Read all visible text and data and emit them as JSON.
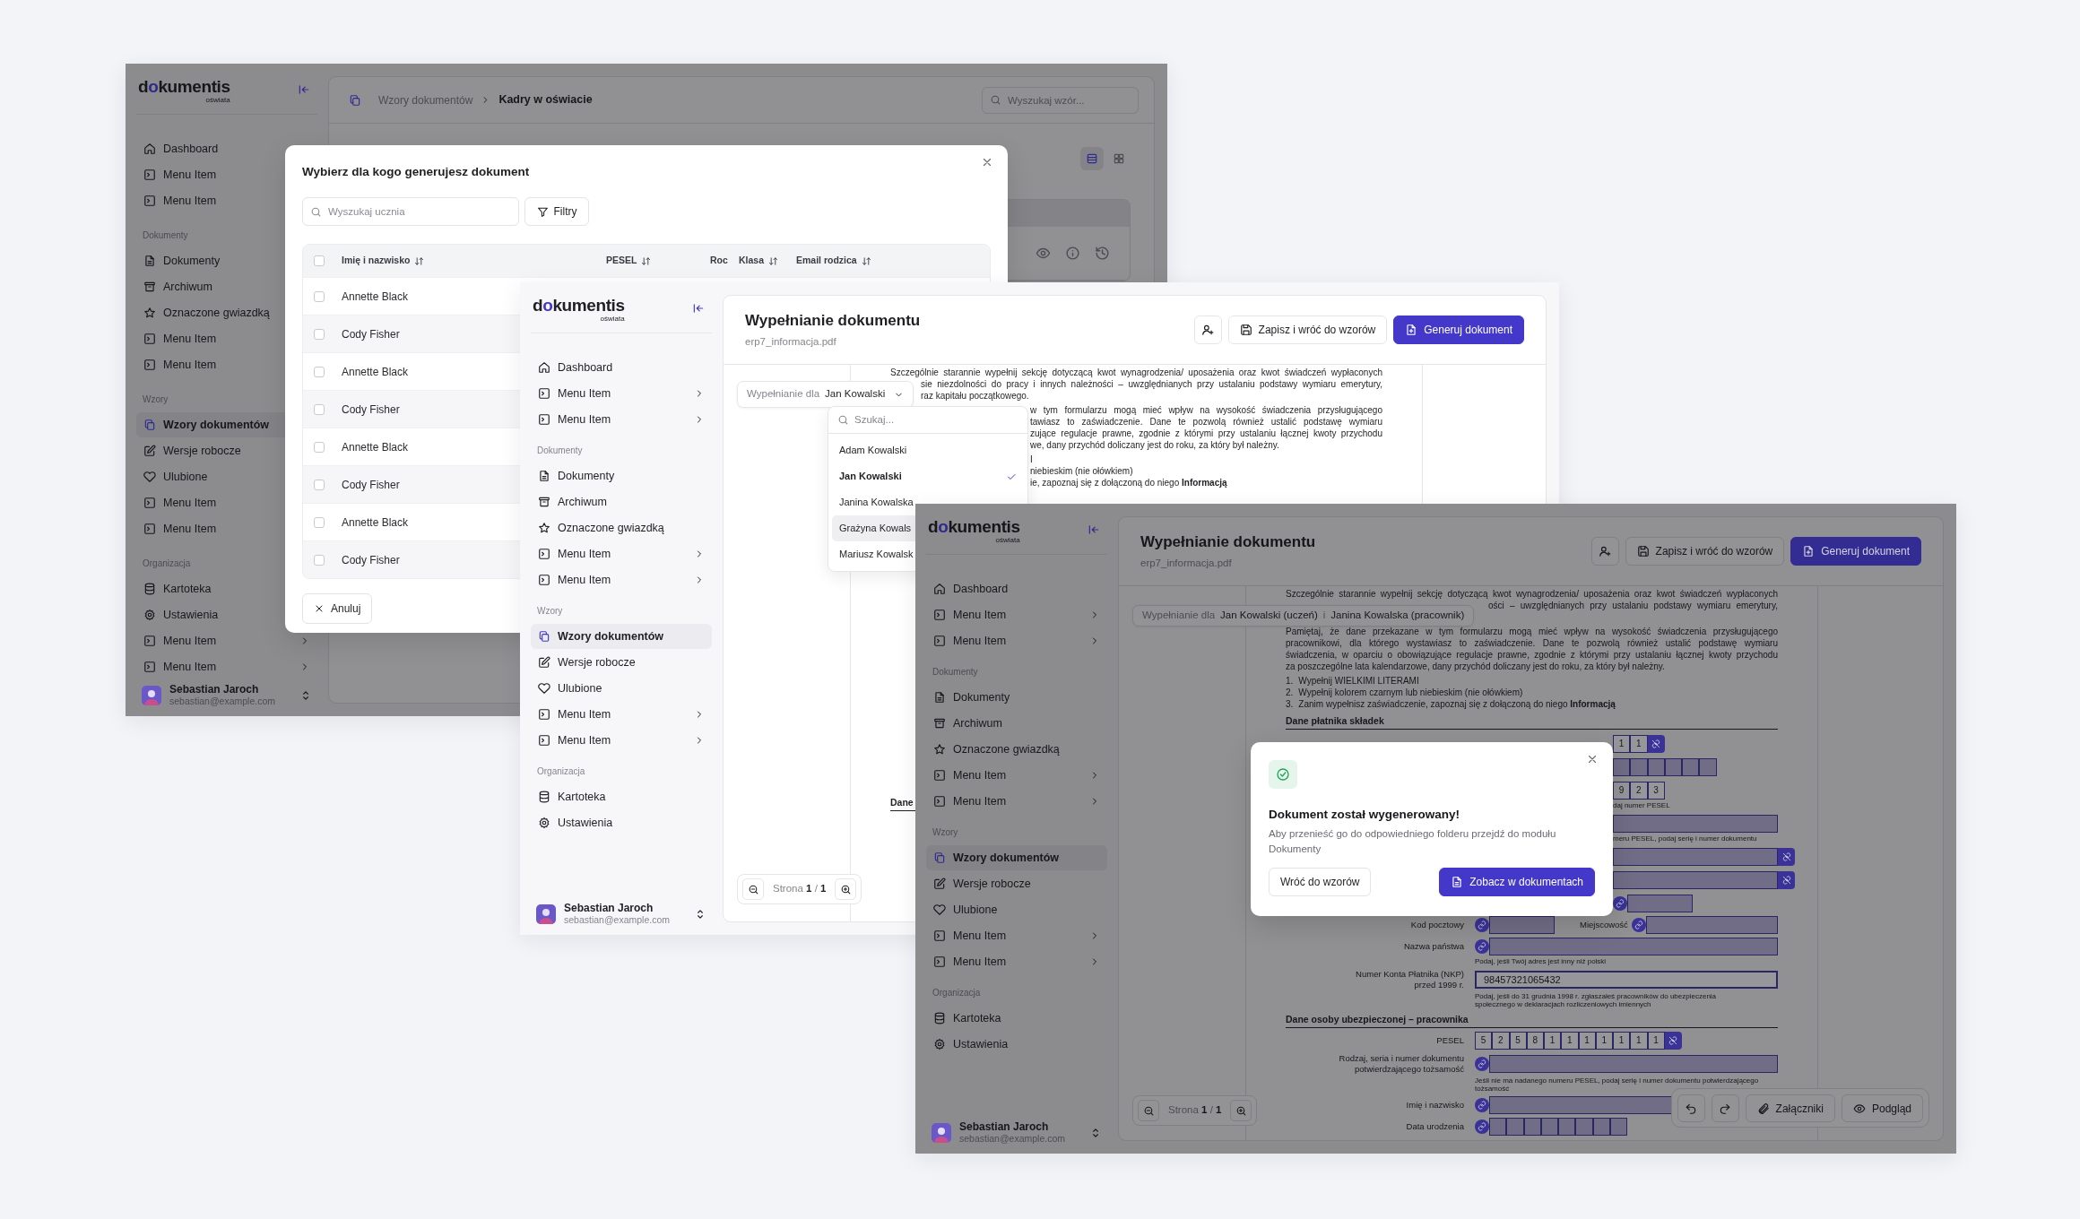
{
  "windows": [
    {
      "backdrop": true,
      "sidebar": {
        "logo": {
          "lead": "d",
          "mark": "o",
          "rest": "kumentis",
          "tagline": "oświata"
        },
        "sections": [
          {
            "items": [
              {
                "text": "Dashboard",
                "selected": false
              },
              {
                "text": "Menu Item",
                "selected": false
              },
              {
                "text": "Menu Item",
                "selected": false
              }
            ]
          },
          {
            "label": "Dokumenty",
            "items": [
              {
                "text": "Dokumenty",
                "selected": false
              },
              {
                "text": "Archiwum",
                "selected": false
              },
              {
                "text": "Oznaczone gwiazdką",
                "selected": false
              },
              {
                "text": "Menu Item",
                "selected": false
              },
              {
                "text": "Menu Item",
                "selected": false
              }
            ]
          },
          {
            "label": "Wzory",
            "items": [
              {
                "text": "Wzory dokumentów",
                "selected": true
              },
              {
                "text": "Wersje robocze",
                "selected": false
              },
              {
                "text": "Ulubione",
                "selected": false
              },
              {
                "text": "Menu Item",
                "selected": false
              },
              {
                "text": "Menu Item",
                "selected": false
              }
            ]
          },
          {
            "label": "Organizacja",
            "items": [
              {
                "text": "Kartoteka",
                "selected": false,
                "kind": "link"
              },
              {
                "text": "Ustawienia",
                "selected": false,
                "kind": "link"
              },
              {
                "text": "Menu Item",
                "selected": false,
                "kind": "submenu"
              },
              {
                "text": "Menu Item",
                "selected": false,
                "kind": "submenu"
              }
            ]
          }
        ],
        "user": {
          "name": "Sebastian Jaroch",
          "email": "sebastian@example.com"
        }
      },
      "main": {
        "kind": "library",
        "breadcrumb": {
          "parent": "Wzory dokumentów",
          "current": "Kadry w oświacie"
        },
        "search": {
          "placeholder": "Wyszukaj wzór..."
        },
        "view_toggle": [
          {
            "selected": true
          },
          {
            "selected": false
          }
        ],
        "modal": {
          "title": "Wybierz dla kogo generujesz dokument",
          "search": {
            "placeholder": "Wyszukaj ucznia"
          },
          "filter_button": "Filtry",
          "select_all": {
            "checked": false
          },
          "columns": [
            {
              "text": "Imię i nazwisko",
              "sortable": true
            },
            {
              "text": "PESEL",
              "sortable": true
            },
            {
              "text": "Roc",
              "sortable": false
            },
            {
              "text": "Klasa",
              "sortable": true
            },
            {
              "text": "Email rodzica",
              "sortable": true
            }
          ],
          "rows": [
            {
              "name": "Annette Black",
              "checked": false
            },
            {
              "name": "Cody Fisher",
              "checked": false
            },
            {
              "name": "Annette Black",
              "checked": false
            },
            {
              "name": "Cody Fisher",
              "checked": false
            },
            {
              "name": "Annette Black",
              "checked": false
            },
            {
              "name": "Cody Fisher",
              "checked": false
            },
            {
              "name": "Annette Black",
              "checked": false
            },
            {
              "name": "Cody Fisher",
              "checked": false
            }
          ],
          "cancel_button": "Anuluj"
        }
      }
    },
    {
      "backdrop": false,
      "sidebar": {
        "logo": {
          "lead": "d",
          "mark": "o",
          "rest": "kumentis",
          "tagline": "oświata"
        },
        "sections": [
          {
            "items": [
              {
                "text": "Dashboard",
                "selected": false,
                "kind": "link"
              },
              {
                "text": "Menu Item",
                "selected": false,
                "kind": "submenu"
              },
              {
                "text": "Menu Item",
                "selected": false,
                "kind": "submenu"
              }
            ]
          },
          {
            "label": "Dokumenty",
            "items": [
              {
                "text": "Dokumenty",
                "selected": false,
                "kind": "link"
              },
              {
                "text": "Archiwum",
                "selected": false,
                "kind": "link"
              },
              {
                "text": "Oznaczone gwiazdką",
                "selected": false,
                "kind": "link"
              },
              {
                "text": "Menu Item",
                "selected": false,
                "kind": "submenu"
              },
              {
                "text": "Menu Item",
                "selected": false,
                "kind": "submenu"
              }
            ]
          },
          {
            "label": "Wzory",
            "items": [
              {
                "text": "Wzory dokumentów",
                "selected": true,
                "kind": "link"
              },
              {
                "text": "Wersje robocze",
                "selected": false,
                "kind": "link"
              },
              {
                "text": "Ulubione",
                "selected": false,
                "kind": "link"
              },
              {
                "text": "Menu Item",
                "selected": false,
                "kind": "submenu"
              },
              {
                "text": "Menu Item",
                "selected": false,
                "kind": "submenu"
              }
            ]
          },
          {
            "label": "Organizacja",
            "items": [
              {
                "text": "Kartoteka",
                "selected": false
              },
              {
                "text": "Ustawienia",
                "selected": false
              }
            ]
          }
        ],
        "user": {
          "name": "Sebastian Jaroch",
          "email": "sebastian@example.com"
        }
      },
      "main": {
        "kind": "editor",
        "title": "Wypełnianie dokumentu",
        "subtitle": "erp7_informacja.pdf",
        "save_button": "Zapisz i wróć do wzorów",
        "generate_button": "Generuj dokument",
        "recipient": {
          "label": "Wypełnianie dla",
          "values": [
            "Jan Kowalski"
          ],
          "caret": true
        },
        "dropdown": {
          "placeholder": "Szukaj...",
          "options": [
            {
              "text": "Adam Kowalski",
              "selected": false,
              "highlighted": false
            },
            {
              "text": "Jan Kowalski",
              "selected": true,
              "highlighted": false
            },
            {
              "text": "Janina Kowalska",
              "selected": false,
              "highlighted": false
            },
            {
              "text": "Grażyna Kowals",
              "selected": false,
              "highlighted": true
            },
            {
              "text": "Mariusz Kowalsk",
              "selected": false,
              "highlighted": false
            }
          ]
        },
        "doc": [
          {
            "kind": "para",
            "lines": [
              {
                "text": "Szczególnie starannie wypełnij sekcję dotyczącą kwot wynagrodzenia/ uposażenia oraz kwot świadczeń wypłaconych",
                "kind": "full"
              },
              {
                "text": "sie niezdolności do pracy i innych należności – uwzględnianych przy ustalaniu podstawy wymiaru emerytury,",
                "kind": "chipcut"
              },
              {
                "text": "raz kapitału początkowego.",
                "kind": "chiptail"
              }
            ]
          },
          {
            "kind": "para",
            "lines": [
              {
                "text": "w tym formularzu mogą mieć wpływ na wysokość świadczenia przysługującego",
                "kind": "menucut"
              },
              {
                "text": "tawiasz to zaświadczenie. Dane te pozwolą również ustalić podstawę wymiaru",
                "kind": "menucut"
              },
              {
                "text": "zujące regulacje prawne, zgodnie z którymi przy ustalaniu łącznej kwoty przychodu",
                "kind": "menucut"
              },
              {
                "text": "we, dany przychód doliczany jest do roku, za który był należny.",
                "kind": "menutail"
              }
            ]
          },
          {
            "kind": "para",
            "lines": [
              {
                "text": "I",
                "kind": "menutail"
              },
              {
                "text": "niebieskim (nie ołówkiem)",
                "kind": "menutail"
              },
              {
                "text": "ie, zapoznaj się z dołączoną do niego **Informacją**",
                "kind": "menutail"
              }
            ]
          },
          {
            "kind": "heading",
            "text": "Dane"
          }
        ],
        "pager": "Strona **1** / **1**"
      }
    },
    {
      "backdrop": true,
      "sidebar": {
        "logo": {
          "lead": "d",
          "mark": "o",
          "rest": "kumentis",
          "tagline": "oświata"
        },
        "sections": [
          {
            "items": [
              {
                "text": "Dashboard",
                "selected": false,
                "kind": "link"
              },
              {
                "text": "Menu Item",
                "selected": false,
                "kind": "submenu"
              },
              {
                "text": "Menu Item",
                "selected": false,
                "kind": "submenu"
              }
            ]
          },
          {
            "label": "Dokumenty",
            "items": [
              {
                "text": "Dokumenty",
                "selected": false,
                "kind": "link"
              },
              {
                "text": "Archiwum",
                "selected": false,
                "kind": "link"
              },
              {
                "text": "Oznaczone gwiazdką",
                "selected": false,
                "kind": "link"
              },
              {
                "text": "Menu Item",
                "selected": false,
                "kind": "submenu"
              },
              {
                "text": "Menu Item",
                "selected": false,
                "kind": "submenu"
              }
            ]
          },
          {
            "label": "Wzory",
            "items": [
              {
                "text": "Wzory dokumentów",
                "selected": true,
                "kind": "link"
              },
              {
                "text": "Wersje robocze",
                "selected": false,
                "kind": "link"
              },
              {
                "text": "Ulubione",
                "selected": false,
                "kind": "link"
              },
              {
                "text": "Menu Item",
                "selected": false,
                "kind": "submenu"
              },
              {
                "text": "Menu Item",
                "selected": false,
                "kind": "submenu"
              }
            ]
          },
          {
            "label": "Organizacja",
            "items": [
              {
                "text": "Kartoteka",
                "selected": false
              },
              {
                "text": "Ustawienia",
                "selected": false
              }
            ]
          }
        ],
        "user": {
          "name": "Sebastian Jaroch",
          "email": "sebastian@example.com"
        }
      },
      "main": {
        "kind": "editor",
        "title": "Wypełnianie dokumentu",
        "subtitle": "erp7_informacja.pdf",
        "save_button": "Zapisz i wróć do wzorów",
        "generate_button": "Generuj dokument",
        "recipient": {
          "label": "Wypełnianie dla",
          "values": [
            "Jan Kowalski (uczeń)",
            "Janina Kowalska (pracownik)"
          ],
          "separator": "i",
          "caret": false
        },
        "doc": [
          {
            "kind": "para",
            "lines": [
              {
                "text": "Szczególnie starannie wypełnij sekcję dotyczącą kwot wynagrodzenia/ uposażenia oraz kwot świadczeń wypłaconych",
                "kind": "full"
              },
              {
                "text": "ości – uwzględnianych przy ustalaniu podstawy wymiaru emerytury,",
                "kind": "chipcut"
              }
            ]
          },
          {
            "kind": "para",
            "lines": [
              {
                "text": "Pamiętaj, że dane przekazane w tym formularzu mogą mieć wpływ na wysokość świadczenia przysługującego",
                "kind": "full"
              },
              {
                "text": "pracownikowi, dla którego wystawiasz to zaświadczenie. Dane te pozwolą również ustalić podstawę wymiaru",
                "kind": "full"
              },
              {
                "text": "świadczenia, w oparciu o obowiązujące regulacje prawne, zgodnie z którymi przy ustalaniu łącznej kwoty przychodu",
                "kind": "full"
              },
              {
                "text": "za poszczególne lata kalendarzowe, dany przychód doliczany jest do roku, za który był należny.",
                "kind": "tail"
              }
            ]
          },
          {
            "kind": "list",
            "items": [
              {
                "number": "1.",
                "text": "Wypełnij WIELKIMI LITERAMI"
              },
              {
                "number": "2.",
                "text": "Wypełnij kolorem czarnym lub niebieskim (nie ołówkiem)"
              },
              {
                "number": "3.",
                "text": "Zanim wypełnisz zaświadczenie, zapoznaj się z dołączoną do niego **Informacją**"
              }
            ]
          },
          {
            "kind": "heading",
            "text": "Dane płatnika składek"
          },
          {
            "kind": "cutrow",
            "parts": [
              {
                "kind": "cells",
                "cells": [
                  {
                    "kind": "digit",
                    "text": "1"
                  },
                  {
                    "kind": "digit",
                    "text": "1"
                  }
                ]
              },
              {
                "kind": "unlink"
              }
            ]
          },
          {
            "kind": "cutrow",
            "parts": [
              {
                "kind": "cells",
                "cells": [
                  {
                    "kind": "blank"
                  },
                  {
                    "kind": "blank"
                  },
                  {
                    "kind": "blank"
                  },
                  {
                    "kind": "blank"
                  },
                  {
                    "kind": "blank"
                  },
                  {
                    "kind": "blank"
                  }
                ]
              }
            ]
          },
          {
            "kind": "cutrow",
            "parts": [
              {
                "kind": "cells",
                "cells": [
                  {
                    "kind": "digit",
                    "text": "9"
                  },
                  {
                    "kind": "digit",
                    "text": "2"
                  },
                  {
                    "kind": "digit",
                    "text": "3"
                  }
                ]
              }
            ]
          },
          {
            "kind": "cuthint",
            "lines": [
              "daj numer PESEL"
            ]
          },
          {
            "kind": "cutrow",
            "parts": [
              {
                "kind": "field"
              }
            ]
          },
          {
            "kind": "cuthint",
            "lines": [
              "meru PESEL, podaj serię i numer dokumentu"
            ]
          },
          {
            "kind": "cutrow",
            "parts": [
              {
                "kind": "field"
              },
              {
                "kind": "unlink"
              }
            ]
          },
          {
            "kind": "cutrow",
            "parts": [
              {
                "kind": "field"
              },
              {
                "kind": "unlink"
              }
            ]
          },
          {
            "kind": "cutrow",
            "parts": [
              {
                "kind": "link"
              },
              {
                "kind": "shortfield"
              }
            ]
          },
          {
            "kind": "row",
            "parts": [
              {
                "kind": "label",
                "lines": [
                  "Kod pocztowy"
                ]
              },
              {
                "kind": "link"
              },
              {
                "kind": "shortfield"
              },
              {
                "kind": "label",
                "lines": [
                  "Miejscowość"
                ]
              },
              {
                "kind": "link"
              },
              {
                "kind": "field"
              }
            ]
          },
          {
            "kind": "row",
            "parts": [
              {
                "kind": "label",
                "lines": [
                  "Nazwa państwa"
                ]
              },
              {
                "kind": "link"
              },
              {
                "kind": "field"
              }
            ]
          },
          {
            "kind": "hint",
            "lines": [
              "Podaj, jeśli Twój adres jest inny niż polski"
            ]
          },
          {
            "kind": "row",
            "parts": [
              {
                "kind": "label",
                "lines": [
                  "Numer Konta Płatnika (NKP)",
                  "przed 1999 r."
                ]
              },
              {
                "kind": "field",
                "value": "98457321065432"
              }
            ]
          },
          {
            "kind": "hint",
            "lines": [
              "Podaj, jeśli do 31 grudnia 1998 r. zgłaszałeś pracowników do ubezpieczenia",
              "społecznego w deklaracjach rozliczeniowych imiennych"
            ]
          },
          {
            "kind": "heading",
            "text": "Dane osoby ubezpieczonej – pracownika"
          },
          {
            "kind": "row",
            "parts": [
              {
                "kind": "label",
                "lines": [
                  "PESEL"
                ]
              },
              {
                "kind": "cells",
                "cells": [
                  {
                    "kind": "digit",
                    "text": "5"
                  },
                  {
                    "kind": "digit",
                    "text": "2"
                  },
                  {
                    "kind": "digit",
                    "text": "5"
                  },
                  {
                    "kind": "digit",
                    "text": "8"
                  },
                  {
                    "kind": "digit",
                    "text": "1"
                  },
                  {
                    "kind": "digit",
                    "text": "1"
                  },
                  {
                    "kind": "digit",
                    "text": "1"
                  },
                  {
                    "kind": "digit",
                    "text": "1"
                  },
                  {
                    "kind": "digit",
                    "text": "1"
                  },
                  {
                    "kind": "digit",
                    "text": "1"
                  },
                  {
                    "kind": "digit",
                    "text": "1"
                  }
                ]
              },
              {
                "kind": "unlink"
              }
            ]
          },
          {
            "kind": "row",
            "parts": [
              {
                "kind": "label",
                "lines": [
                  "Rodzaj, seria i numer dokumentu",
                  "potwierdzającego tożsamość"
                ]
              },
              {
                "kind": "link"
              },
              {
                "kind": "field"
              }
            ]
          },
          {
            "kind": "hint",
            "lines": [
              "Jeśli nie ma nadanego numeru PESEL, podaj serię i numer dokumentu potwierdzającego",
              "tożsamość"
            ]
          },
          {
            "kind": "row",
            "parts": [
              {
                "kind": "label",
                "lines": [
                  "Imię i nazwisko"
                ]
              },
              {
                "kind": "link"
              },
              {
                "kind": "mediumfield"
              }
            ]
          },
          {
            "kind": "row",
            "parts": [
              {
                "kind": "label",
                "lines": [
                  "Data urodzenia"
                ]
              },
              {
                "kind": "link"
              },
              {
                "kind": "cells",
                "cells": [
                  {
                    "kind": "blank"
                  },
                  {
                    "kind": "blank"
                  },
                  {
                    "kind": "blank"
                  },
                  {
                    "kind": "blank"
                  },
                  {
                    "kind": "blank"
                  },
                  {
                    "kind": "blank"
                  },
                  {
                    "kind": "blank"
                  },
                  {
                    "kind": "blank"
                  }
                ]
              }
            ]
          }
        ],
        "pager": "Strona **1** / **1**",
        "toolbar": {
          "attachments": "Załączniki",
          "preview": "Podgląd"
        },
        "modal": {
          "title": "Dokument został wygenerowany!",
          "text": "Aby przenieść go do odpowiedniego folderu przejdź do modułu Dokumenty",
          "back_button": "Wróć do wzorów",
          "open_button": "Zobacz w dokumentach"
        }
      }
    }
  ]
}
